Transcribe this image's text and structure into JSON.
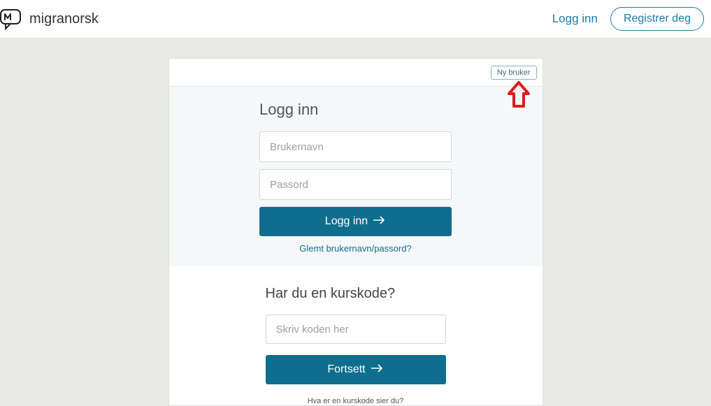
{
  "header": {
    "brand": "migranorsk",
    "login_link": "Logg inn",
    "register_btn": "Registrer deg"
  },
  "card": {
    "new_user_btn": "Ny bruker"
  },
  "login": {
    "title": "Logg inn",
    "username_placeholder": "Brukernavn",
    "password_placeholder": "Passord",
    "submit": "Logg inn",
    "forgot": "Glemt brukernavn/passord?"
  },
  "kurskode": {
    "title": "Har du en kurskode?",
    "code_placeholder": "Skriv koden her",
    "submit": "Fortsett",
    "help": "Hva er en kurskode sier du?"
  }
}
